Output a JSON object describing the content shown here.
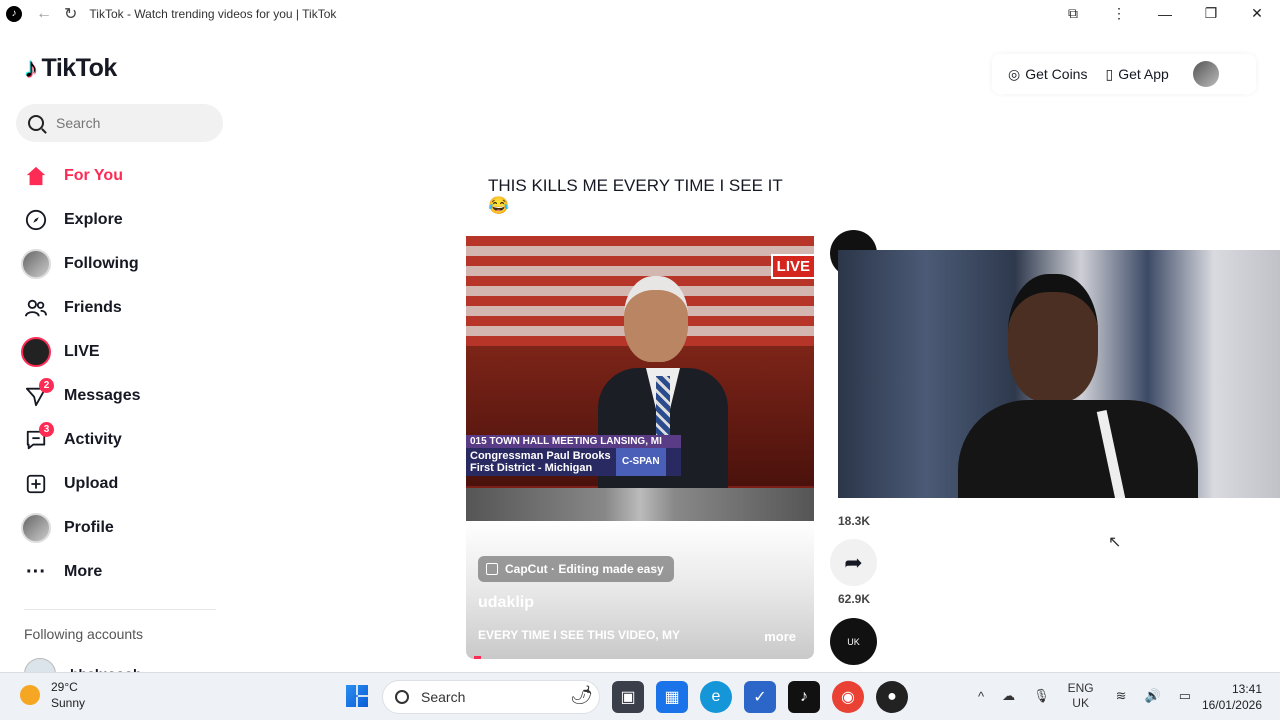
{
  "browser": {
    "tab_title": "TikTok - Watch trending videos for you | TikTok"
  },
  "brand": {
    "name": "TikTok",
    "accent": "#fe2c55"
  },
  "search": {
    "placeholder": "Search"
  },
  "nav": {
    "items": [
      {
        "label": "For You",
        "icon": "home-icon",
        "active": true
      },
      {
        "label": "Explore",
        "icon": "compass-icon"
      },
      {
        "label": "Following",
        "icon": "following-avatar"
      },
      {
        "label": "Friends",
        "icon": "friends-icon"
      },
      {
        "label": "LIVE",
        "icon": "live-avatar"
      },
      {
        "label": "Messages",
        "icon": "messages-icon",
        "badge": "2"
      },
      {
        "label": "Activity",
        "icon": "activity-icon",
        "badge": "3"
      },
      {
        "label": "Upload",
        "icon": "upload-icon"
      },
      {
        "label": "Profile",
        "icon": "profile-avatar"
      },
      {
        "label": "More",
        "icon": "more-icon"
      }
    ]
  },
  "following": {
    "heading": "Following accounts",
    "accounts": [
      {
        "name": "bhaluooob"
      }
    ]
  },
  "header": {
    "get_coins": "Get Coins",
    "get_app": "Get App"
  },
  "video": {
    "title": "THIS KILLS ME EVERY TIME I SEE IT 😂",
    "live_tag": "LIVE",
    "lower_third_top": "015 TOWN HALL MEETING  LANSING, MI",
    "lower_third_name": "Congressman Paul Brooks First District - Michigan",
    "lower_third_network": "C-SPAN",
    "capcut": "CapCut · Editing made easy",
    "author": "udaklip",
    "description": "EVERY TIME I SEE THIS VIDEO, MY",
    "more": "more",
    "progress": 0.02
  },
  "actions": {
    "comments_count": "18.3K",
    "shares_count": "62.9K",
    "avatar_text": "UK"
  },
  "taskbar": {
    "temperature": "29°C",
    "condition": "Sunny",
    "search": "Search",
    "lang_line1": "ENG",
    "lang_line2": "UK",
    "time": "13:41",
    "date": "16/01/2026"
  }
}
